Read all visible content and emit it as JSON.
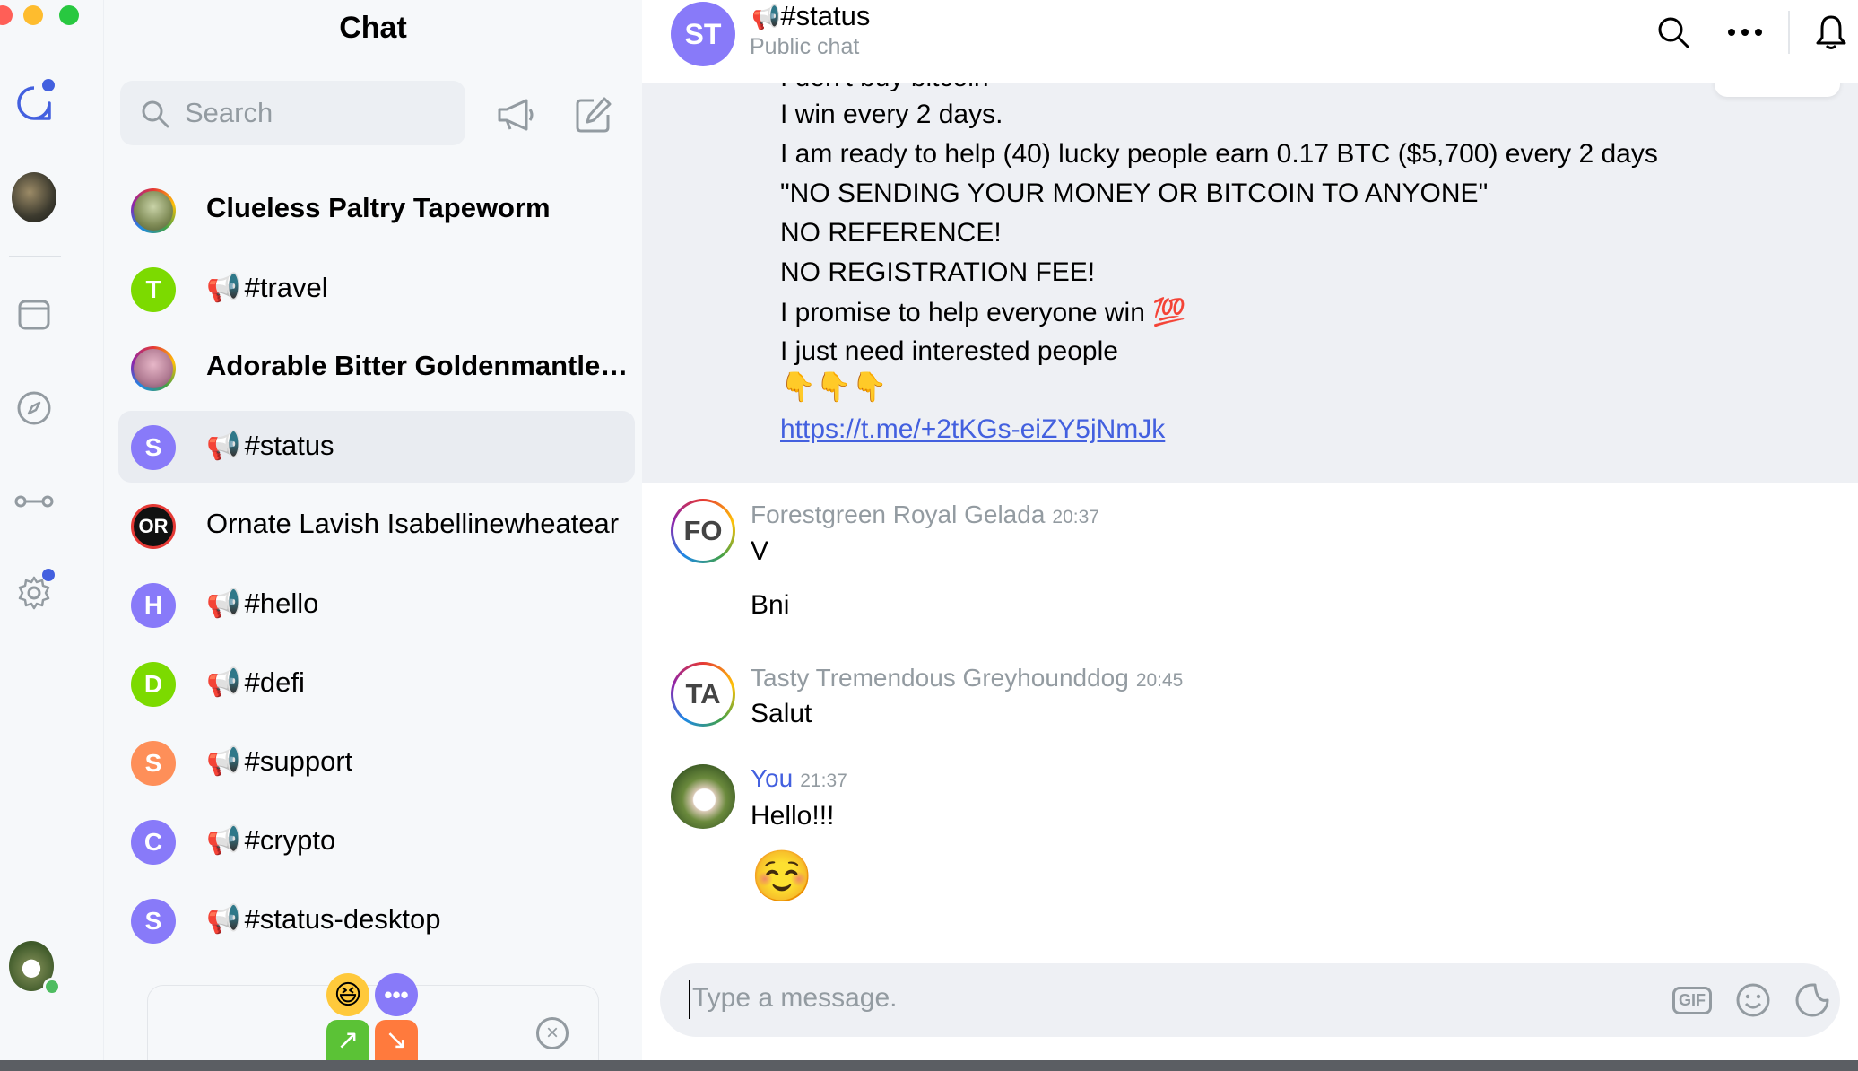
{
  "app": {
    "window_controls": [
      "close",
      "minimize",
      "maximize"
    ]
  },
  "colors": {
    "accent": "#4360df",
    "list_bg": "#f6f8fa",
    "highlight_bg": "#eef0f4"
  },
  "rail": {
    "icons": [
      "chat-icon",
      "community-avatar",
      "wallet-icon",
      "browser-icon",
      "keycard-icon",
      "settings-icon",
      "profile-avatar"
    ]
  },
  "chat_list": {
    "title": "Chat",
    "search": {
      "placeholder": "Search"
    },
    "items": [
      {
        "name": "Clueless Paltry Tapeworm",
        "avatar": "",
        "bold": true,
        "channel": false
      },
      {
        "name": "#travel",
        "avatar": "T",
        "bold": false,
        "channel": true,
        "color": "#7cda00"
      },
      {
        "name": "Adorable Bitter Goldenmantled...",
        "avatar": "",
        "bold": true,
        "channel": false
      },
      {
        "name": "#status",
        "avatar": "S",
        "bold": false,
        "channel": true,
        "color": "#887af9",
        "active": true
      },
      {
        "name": "Ornate Lavish Isabellinewheatear",
        "avatar": "OR",
        "bold": false,
        "channel": false
      },
      {
        "name": "#hello",
        "avatar": "H",
        "bold": false,
        "channel": true,
        "color": "#887af9"
      },
      {
        "name": "#defi",
        "avatar": "D",
        "bold": false,
        "channel": true,
        "color": "#7cda00"
      },
      {
        "name": "#support",
        "avatar": "S",
        "bold": false,
        "channel": true,
        "color": "#fe8f59"
      },
      {
        "name": "#crypto",
        "avatar": "C",
        "bold": false,
        "channel": true,
        "color": "#887af9"
      },
      {
        "name": "#status-desktop",
        "avatar": "S",
        "bold": false,
        "channel": true,
        "color": "#887af9"
      }
    ]
  },
  "header": {
    "avatar": "ST",
    "title": "#status",
    "subtitle": "Public chat"
  },
  "messages": {
    "highlighted_lines": [
      "I win every 2 days.",
      "I am ready to help (40) lucky people earn 0.17 BTC ($5,700) every 2 days",
      "\"NO SENDING YOUR MONEY OR BITCOIN TO ANYONE\"",
      "NO REFERENCE!",
      "NO REGISTRATION FEE!",
      "I promise to help everyone win 💯",
      "I just need interested people",
      "👇👇👇"
    ],
    "link": "https://t.me/+2tKGs-eiZY5jNmJk",
    "list": [
      {
        "avatar": "FO",
        "sender": "Forestgreen Royal Gelada",
        "time": "20:37",
        "lines": [
          "V",
          "Bni"
        ]
      },
      {
        "avatar": "TA",
        "sender": "Tasty Tremendous Greyhounddog",
        "time": "20:45",
        "lines": [
          "Salut"
        ]
      },
      {
        "avatar": "",
        "sender": "You",
        "time": "21:37",
        "lines": [
          "Hello!!!",
          "☺️"
        ]
      }
    ]
  },
  "input": {
    "placeholder": "Type a message.",
    "gif_label": "GIF"
  }
}
